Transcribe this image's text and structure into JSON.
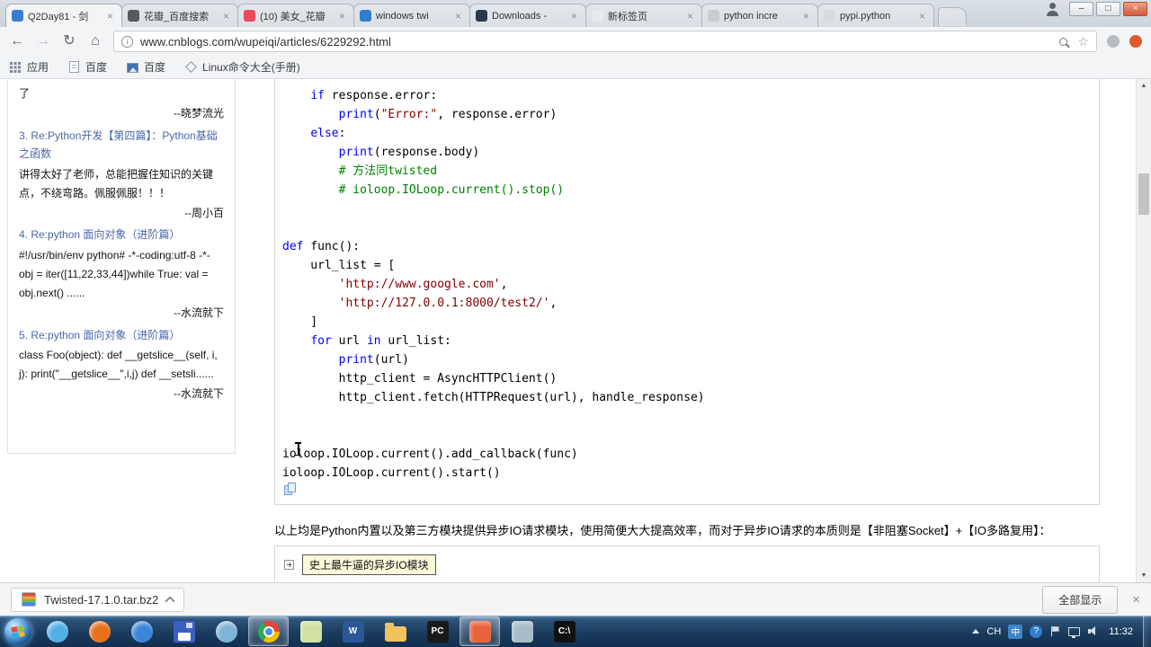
{
  "glyphs": {
    "back": "←",
    "forward": "→",
    "refresh": "↻",
    "home": "⌂",
    "star": "☆",
    "tab_close": "×",
    "win_min": "–",
    "win_max": "□",
    "win_close": "×",
    "download_close": "×",
    "scroll_up": "▲",
    "scroll_down": "▼",
    "info": "i",
    "help": "?"
  },
  "browser": {
    "tabs": [
      {
        "title": "Q2Day81 - 剑",
        "icon_color": "#3b7bd4",
        "active": true
      },
      {
        "title": "花瓣_百度搜索",
        "icon_color": "#5a5a5a",
        "active": false
      },
      {
        "title": "(10) 美女_花瓣",
        "icon_color": "#ea4a5a",
        "active": false
      },
      {
        "title": "windows twi",
        "icon_color": "#2f7fd0",
        "active": false
      },
      {
        "title": "Downloads -",
        "icon_color": "#2b3a4a",
        "active": false
      },
      {
        "title": "新标签页",
        "icon_color": "#e8eaed",
        "active": false
      },
      {
        "title": "python incre",
        "icon_color": "#c8cdd2",
        "active": false
      },
      {
        "title": "pypi.python",
        "icon_color": "#d8dce0",
        "active": false
      }
    ]
  },
  "navbar": {
    "url": "www.cnblogs.com/wupeiqi/articles/6229292.html"
  },
  "bookmarks": [
    {
      "label": "应用",
      "icon": "grid"
    },
    {
      "label": "百度",
      "icon": "page"
    },
    {
      "label": "百度",
      "icon": "image"
    },
    {
      "label": "Linux命令大全(手册)",
      "icon": "diamond"
    }
  ],
  "sidebar": {
    "entries": [
      {
        "title": "",
        "body": "了",
        "author": "--晓梦流光"
      },
      {
        "title": "3. Re:Python开发【第四篇】：Python基础之函数",
        "body": "讲得太好了老师，总能把握住知识的关键点，不绕弯路。佩服佩服！！！",
        "author": "--周小百"
      },
      {
        "title": "4. Re:python 面向对象（进阶篇）",
        "body": "#!/usr/bin/env python# -*-coding:utf-8 -*-obj = iter([11,22,33,44])while True: val = obj.next() ......",
        "author": "--水流就下"
      },
      {
        "title": "5. Re:python 面向对象（进阶篇）",
        "body": "class Foo(object): def __getslice__(self, i, j): print(\"__getslice__\",i,j) def __setsli......",
        "author": "--水流就下"
      }
    ]
  },
  "code_block": {
    "lines": [
      [
        {
          "t": "    ",
          "c": "p"
        },
        {
          "t": "if",
          "c": "k"
        },
        {
          "t": " response.error:",
          "c": "p"
        }
      ],
      [
        {
          "t": "        ",
          "c": "p"
        },
        {
          "t": "print",
          "c": "k"
        },
        {
          "t": "(",
          "c": "p"
        },
        {
          "t": "\"Error:\"",
          "c": "s"
        },
        {
          "t": ", response.error)",
          "c": "p"
        }
      ],
      [
        {
          "t": "    ",
          "c": "p"
        },
        {
          "t": "else",
          "c": "k"
        },
        {
          "t": ":",
          "c": "p"
        }
      ],
      [
        {
          "t": "        ",
          "c": "p"
        },
        {
          "t": "print",
          "c": "k"
        },
        {
          "t": "(response.body)",
          "c": "p"
        }
      ],
      [
        {
          "t": "        ",
          "c": "p"
        },
        {
          "t": "# 方法同twisted",
          "c": "c"
        }
      ],
      [
        {
          "t": "        ",
          "c": "p"
        },
        {
          "t": "# ioloop.IOLoop.current().stop()",
          "c": "c"
        }
      ],
      [],
      [],
      [
        {
          "t": "def",
          "c": "k"
        },
        {
          "t": " func():",
          "c": "p"
        }
      ],
      [
        {
          "t": "    url_list = [",
          "c": "p"
        }
      ],
      [
        {
          "t": "        ",
          "c": "p"
        },
        {
          "t": "'http://www.google.com'",
          "c": "s"
        },
        {
          "t": ",",
          "c": "p"
        }
      ],
      [
        {
          "t": "        ",
          "c": "p"
        },
        {
          "t": "'http://127.0.0.1:8000/test2/'",
          "c": "s"
        },
        {
          "t": ",",
          "c": "p"
        }
      ],
      [
        {
          "t": "    ]",
          "c": "p"
        }
      ],
      [
        {
          "t": "    ",
          "c": "p"
        },
        {
          "t": "for",
          "c": "k"
        },
        {
          "t": " url ",
          "c": "p"
        },
        {
          "t": "in",
          "c": "k"
        },
        {
          "t": " url_list:",
          "c": "p"
        }
      ],
      [
        {
          "t": "        ",
          "c": "p"
        },
        {
          "t": "print",
          "c": "k"
        },
        {
          "t": "(url)",
          "c": "p"
        }
      ],
      [
        {
          "t": "        http_client = AsyncHTTPClient()",
          "c": "p"
        }
      ],
      [
        {
          "t": "        http_client.fetch(HTTPRequest(url), handle_response)",
          "c": "p"
        }
      ],
      [],
      [],
      [
        {
          "t": "ioloop.IOLoop.current().add_callback(func)",
          "c": "p"
        }
      ],
      [
        {
          "t": "ioloop.IOLoop.current().start()",
          "c": "p"
        }
      ]
    ]
  },
  "article": {
    "note": "以上均是Python内置以及第三方模块提供异步IO请求模块，使用简便大大提高效率，而对于异步IO请求的本质则是【非阻塞Socket】+【IO多路复用】：",
    "collapsed_block_title": "史上最牛逼的异步IO模块"
  },
  "download_bar": {
    "filename": "Twisted-17.1.0.tar.bz2",
    "show_all_label": "全部显示"
  },
  "taskbar": {
    "apps": [
      {
        "name": "messenger",
        "shape": "circle",
        "color": "#53aee4",
        "active": false
      },
      {
        "name": "firefox",
        "shape": "circle",
        "color": "#e8701a",
        "active": false
      },
      {
        "name": "thunder",
        "shape": "circle",
        "color": "#3a86d8",
        "active": false
      },
      {
        "name": "save-tool",
        "shape": "floppy",
        "color": "#3b5fc0",
        "active": false
      },
      {
        "name": "ie",
        "shape": "circle",
        "color": "#7fb3d8",
        "active": false
      },
      {
        "name": "chrome",
        "shape": "chrome",
        "color": "#4a90e2",
        "active": true
      },
      {
        "name": "notepad",
        "shape": "square",
        "color": "#cfe0a0",
        "active": false
      },
      {
        "name": "word",
        "shape": "letter",
        "color": "#2b5797",
        "letter": "W",
        "active": false
      },
      {
        "name": "explorer-folder",
        "shape": "folder",
        "color": "#f2c35c",
        "active": false
      },
      {
        "name": "pycharm",
        "shape": "letter",
        "color": "#1a1a1a",
        "letter": "PC",
        "active": false
      },
      {
        "name": "editor",
        "shape": "square",
        "color": "#e8643c",
        "active": true
      },
      {
        "name": "viewer",
        "shape": "square",
        "color": "#a8bccb",
        "active": false
      },
      {
        "name": "cmd",
        "shape": "letter",
        "color": "#111111",
        "letter": "C:\\",
        "active": false
      }
    ],
    "tray": {
      "lang": "CH",
      "ime": "中",
      "help": "?",
      "time": "11:32"
    }
  }
}
